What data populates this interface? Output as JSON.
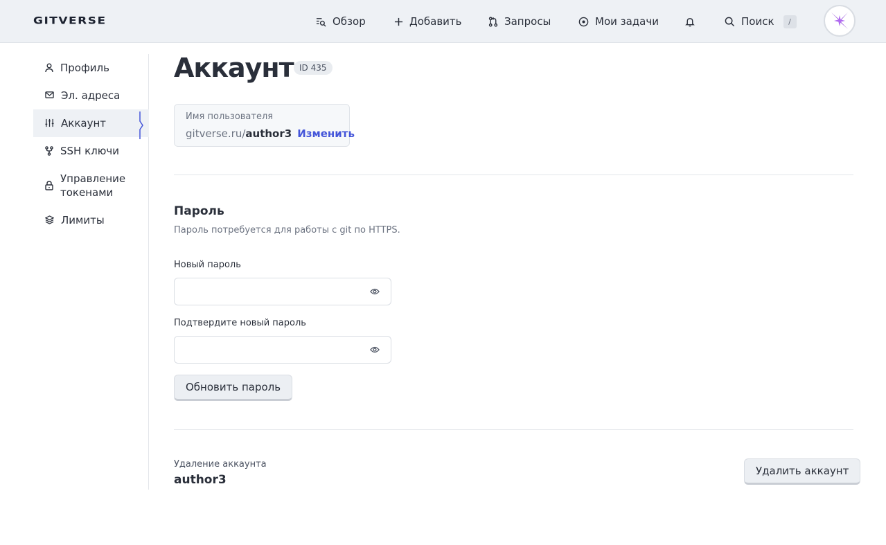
{
  "header": {
    "logo": "GITVERSE",
    "nav": {
      "overview": "Обзор",
      "add": "Добавить",
      "requests": "Запросы",
      "my_tasks": "Мои задачи",
      "search": "Поиск",
      "search_shortcut": "/"
    }
  },
  "sidebar": {
    "profile": "Профиль",
    "emails": "Эл. адреса",
    "account": "Аккаунт",
    "ssh_keys": "SSH ключи",
    "tokens_line1": "Управление",
    "tokens_line2": "токенами",
    "limits": "Лимиты"
  },
  "main": {
    "title": "Аккаунт",
    "id_badge": "ID 435",
    "username_card": {
      "label": "Имя пользователя",
      "domain": "gitverse.ru/",
      "username": "author3",
      "change_link": "Изменить"
    },
    "password": {
      "title": "Пароль",
      "description": "Пароль потребуется для работы с git по HTTPS.",
      "new_label": "Новый пароль",
      "new_value": "",
      "confirm_label": "Подтвердите новый пароль",
      "confirm_value": "",
      "update_button": "Обновить пароль"
    },
    "delete": {
      "label": "Удаление аккаунта",
      "username": "author3",
      "button": "Удалить аккаунт"
    }
  },
  "colors": {
    "accent": "#4455d9",
    "header_bg": "#eef1f5",
    "avatar_purple": "#7a1fd1"
  }
}
